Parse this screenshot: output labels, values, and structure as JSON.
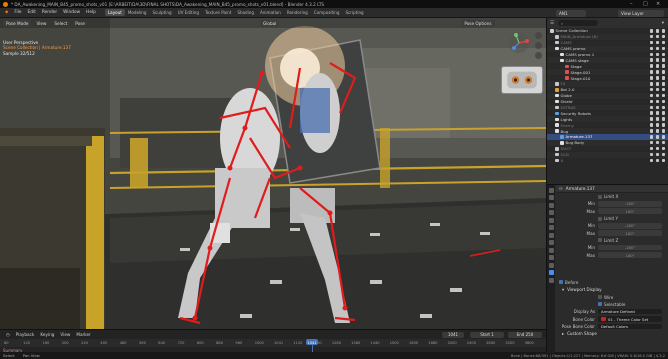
{
  "title_bar": {
    "title": "* DA_Awakening_MAIN_B45_promo_shots_v01 [E:\\ARBEIT\\DA\\3D\\FINAL SHOTS\\DA_Awakening_MAIN_B45_promo_shots_v01.blend] - Blender 4.3.2 LTS"
  },
  "menu": {
    "items": [
      "File",
      "Edit",
      "Render",
      "Window",
      "Help"
    ],
    "tabs": [
      "Layout",
      "Modeling",
      "Sculpting",
      "UV Editing",
      "Texture Paint",
      "Shading",
      "Animation",
      "Rendering",
      "Compositing",
      "Scripting"
    ],
    "active_tab": "Layout",
    "scene": "AN1",
    "view_layer": "View Layer"
  },
  "viewport": {
    "mode": "Pose Mode",
    "menus": [
      "View",
      "Select",
      "Pose"
    ],
    "orientation": "Global",
    "info_line1": "User Perspective",
    "info_line2": "Scene Collection | Armature.137",
    "info_line3": "Sample 32/512",
    "pose_options": "Pose Options",
    "armature_label": "Armature.137"
  },
  "timeline": {
    "playback": "Playback",
    "keying": "Keying",
    "view": "View",
    "marker": "Marker",
    "current_frame": "1041",
    "start_label": "Start",
    "start": "1",
    "end_label": "End",
    "end": "250",
    "ticks": [
      "80",
      "120",
      "160",
      "200",
      "240",
      "400",
      "480",
      "560",
      "640",
      "720",
      "800",
      "880",
      "960",
      "1000",
      "1041",
      "1120",
      "1200",
      "1280",
      "1360",
      "1440",
      "1500",
      "1600",
      "1680",
      "2000",
      "2400",
      "2800",
      "3200",
      "3600"
    ],
    "summary": "Summary"
  },
  "status": {
    "left": "Select",
    "left2": "Pan View",
    "right": "Bone | Bones:68/391 | Objects:1/1,227 | Memory: 6.6 GiB | VRAM: 5.6/16.0 GiB | 4.3.2"
  },
  "outliner": {
    "search_placeholder": "",
    "rows": [
      {
        "label": "Scene Collection",
        "color": "#cccccc",
        "indent": 0,
        "state": ""
      },
      {
        "label": "MAIN_Armature (B)",
        "color": "#c8c8c8",
        "indent": 1,
        "state": "dim"
      },
      {
        "label": "CAMS",
        "color": "#c8c8c8",
        "indent": 1,
        "state": "dim"
      },
      {
        "label": "CAMS promo",
        "color": "#e0e0e0",
        "indent": 1,
        "state": ""
      },
      {
        "label": "CAMS promo 1",
        "color": "#e0e0e0",
        "indent": 2,
        "state": ""
      },
      {
        "label": "CAMS stage",
        "color": "#e0e0e0",
        "indent": 2,
        "state": ""
      },
      {
        "label": "Stage",
        "color": "#e05050",
        "indent": 3,
        "state": ""
      },
      {
        "label": "Stage.001",
        "color": "#e05050",
        "indent": 3,
        "state": ""
      },
      {
        "label": "Stage.010",
        "color": "#e05050",
        "indent": 3,
        "state": ""
      },
      {
        "label": "FX",
        "color": "#c8c8c8",
        "indent": 1,
        "state": "dim"
      },
      {
        "label": "Bot 2.0",
        "color": "#e0a030",
        "indent": 1,
        "state": ""
      },
      {
        "label": "Globe",
        "color": "#e0e0e0",
        "indent": 1,
        "state": ""
      },
      {
        "label": "Shield",
        "color": "#e0e0e0",
        "indent": 1,
        "state": ""
      },
      {
        "label": "EXTRAS",
        "color": "#c8c8c8",
        "indent": 1,
        "state": "dim"
      },
      {
        "label": "Security Robots",
        "color": "#5aa0e0",
        "indent": 1,
        "state": ""
      },
      {
        "label": "Lights",
        "color": "#e0e0e0",
        "indent": 1,
        "state": ""
      },
      {
        "label": "Enemy",
        "color": "#e0e0e0",
        "indent": 1,
        "state": "dim"
      },
      {
        "label": "Bug",
        "color": "#e0e0e0",
        "indent": 1,
        "state": ""
      },
      {
        "label": "Armature.137",
        "color": "#5aa0e0",
        "indent": 2,
        "state": "sel"
      },
      {
        "label": "Bug Body",
        "color": "#e0e0e0",
        "indent": 2,
        "state": ""
      },
      {
        "label": "DUST",
        "color": "#c8c8c8",
        "indent": 1,
        "state": "dim"
      },
      {
        "label": "OLD",
        "color": "#c8c8c8",
        "indent": 1,
        "state": "dim"
      },
      {
        "label": "X",
        "color": "#c8c8c8",
        "indent": 1,
        "state": "dim"
      }
    ]
  },
  "properties": {
    "object_name": "Armature.137",
    "limit_x": "Limit X",
    "limit_y": "Limit Y",
    "limit_z": "Limit Z",
    "min_label": "Min",
    "max_label": "Max",
    "min_value": "-180°",
    "max_value": "180°",
    "before_label": "Before",
    "viewport_display": "Viewport Display",
    "wire_label": "Wire",
    "selectable_label": "Selectable",
    "display_as_label": "Display As",
    "display_as_value": "Armature Defined",
    "bone_color_label": "Bone Color",
    "bone_color_value": "01 - Theme Color Set",
    "pose_bone_color_label": "Pose Bone Color",
    "pose_bone_color_value": "Default Colors",
    "custom_shape": "Custom Shape"
  }
}
